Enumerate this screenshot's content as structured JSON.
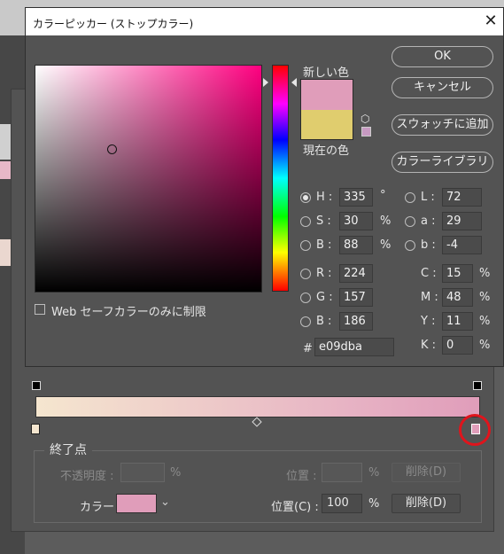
{
  "colors": {
    "new_color": "#e09dba",
    "current_color": "#e0cd6e",
    "highlight": "#e0141c",
    "gradient_start": "#f5e6cf",
    "gradient_end": "#e09dba"
  },
  "picker": {
    "title": "カラーピッカー (ストップカラー)",
    "close_icon": "close-icon",
    "new_label": "新しい色",
    "current_label": "現在の色",
    "buttons": {
      "ok": "OK",
      "cancel": "キャンセル",
      "add_swatch": "スウォッチに追加",
      "color_library": "カラーライブラリ"
    },
    "web_safe_label": "Web セーフカラーのみに制限",
    "hsb": [
      {
        "label": "H :",
        "value": "335",
        "unit": "°",
        "selected": true
      },
      {
        "label": "S :",
        "value": "30",
        "unit": "%",
        "selected": false
      },
      {
        "label": "B :",
        "value": "88",
        "unit": "%",
        "selected": false
      }
    ],
    "rgb": [
      {
        "label": "R :",
        "value": "224"
      },
      {
        "label": "G :",
        "value": "157"
      },
      {
        "label": "B :",
        "value": "186"
      }
    ],
    "lab": [
      {
        "label": "L :",
        "value": "72"
      },
      {
        "label": "a :",
        "value": "29"
      },
      {
        "label": "b :",
        "value": "-4"
      }
    ],
    "cmyk": [
      {
        "label": "C :",
        "value": "15",
        "unit": "%"
      },
      {
        "label": "M :",
        "value": "48",
        "unit": "%"
      },
      {
        "label": "Y :",
        "value": "11",
        "unit": "%"
      },
      {
        "label": "K :",
        "value": "0",
        "unit": "%"
      }
    ],
    "hex_label": "#",
    "hex_value": "e09dba"
  },
  "gradient_editor": {
    "endpoint_title": "終了点",
    "opacity_label": "不透明度 :",
    "opacity_unit": "%",
    "location_label_disabled": "位置 :",
    "location_unit_disabled": "%",
    "delete_disabled": "削除(D)",
    "color_label": "カラー :",
    "location_label": "位置(C) :",
    "location_value": "100",
    "location_unit": "%",
    "delete_label": "削除(D)"
  }
}
